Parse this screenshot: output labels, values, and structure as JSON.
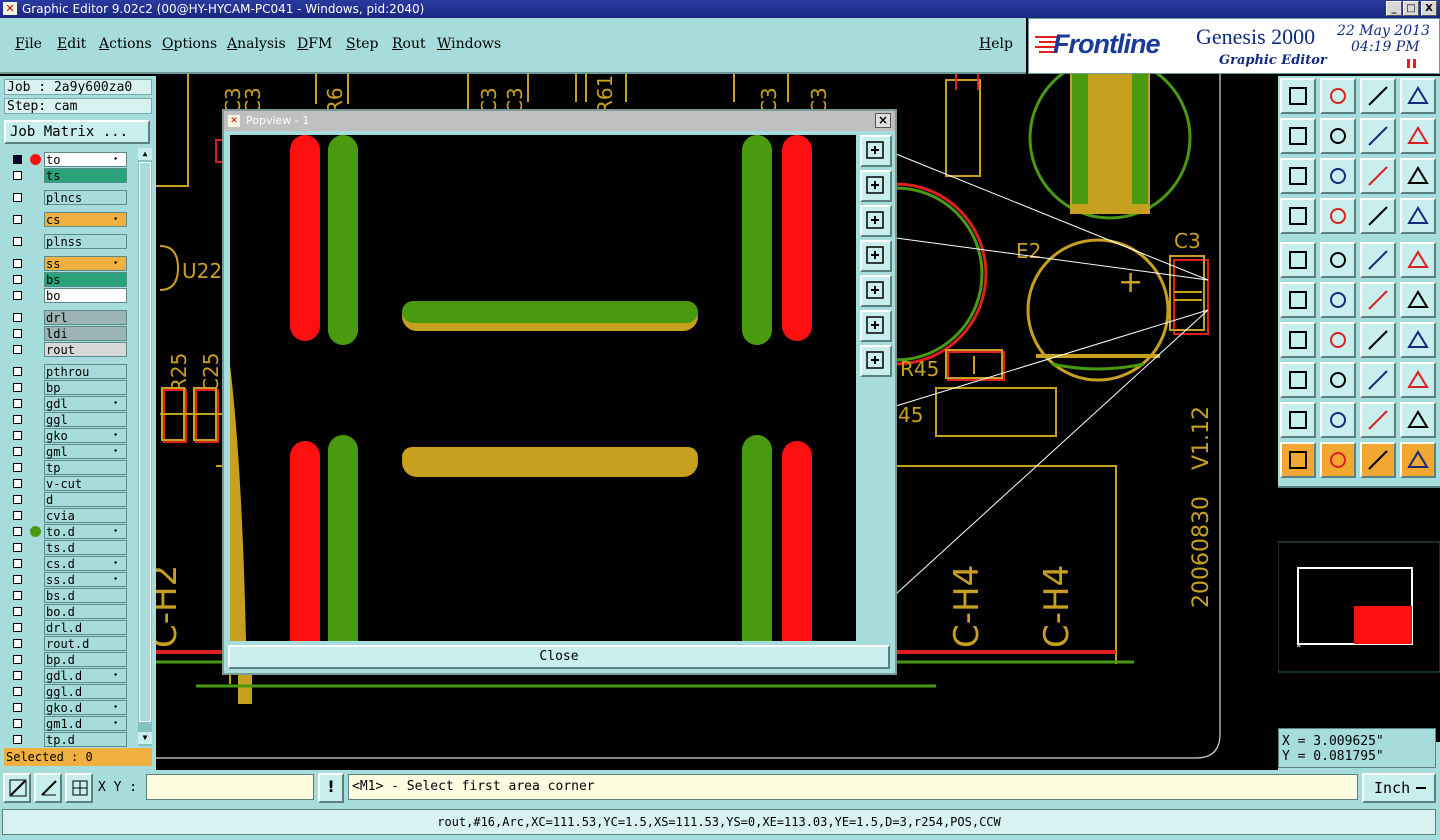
{
  "window": {
    "title": "Graphic Editor 9.02c2 (00@HY-HYCAM-PC041 - Windows, pid:2040)",
    "minimize_glyph": "_",
    "maximize_glyph": "□",
    "close_glyph": "X"
  },
  "menu": {
    "items": [
      {
        "first": "F",
        "rest": "ile"
      },
      {
        "first": "E",
        "rest": "dit"
      },
      {
        "first": "A",
        "rest": "ctions"
      },
      {
        "first": "O",
        "rest": "ptions"
      },
      {
        "first": "A",
        "rest": "nalysis"
      },
      {
        "first": "D",
        "rest": "FM"
      },
      {
        "first": "S",
        "rest": "tep"
      },
      {
        "first": "R",
        "rest": "out"
      },
      {
        "first": "W",
        "rest": "indows"
      }
    ],
    "help": {
      "first": "H",
      "rest": "elp"
    }
  },
  "brand": {
    "logo": "Frontline",
    "product": "Genesis 2000",
    "date": "22 May 2013",
    "time": "04:19 PM",
    "subtitle": "Graphic Editor"
  },
  "job": {
    "job_label": "Job : 2a9y600za0",
    "step_label": "Step: cam",
    "matrix_button": "Job Matrix ..."
  },
  "layers": [
    {
      "name": "to",
      "color": "#ffffff",
      "checked": true,
      "marker": "⬩"
    },
    {
      "name": "ts",
      "color": "#2ba37a",
      "checked": false,
      "marker": ""
    },
    {
      "name": "plncs",
      "color": "#a6dcdc",
      "checked": false,
      "marker": ""
    },
    {
      "name": "cs",
      "color": "#f0b040",
      "checked": false,
      "marker": "⬩"
    },
    {
      "name": "plnss",
      "color": "#a6dcdc",
      "checked": false,
      "marker": ""
    },
    {
      "name": "ss",
      "color": "#f0b040",
      "checked": false,
      "marker": "⬩"
    },
    {
      "name": "bs",
      "color": "#2ba37a",
      "checked": false,
      "marker": ""
    },
    {
      "name": "bo",
      "color": "#ffffff",
      "checked": false,
      "marker": ""
    },
    {
      "name": "drl",
      "color": "#9cb4b4",
      "checked": false,
      "marker": ""
    },
    {
      "name": "ldi",
      "color": "#9cb4b4",
      "checked": false,
      "marker": ""
    },
    {
      "name": "rout",
      "color": "#d8d8d8",
      "checked": false,
      "marker": ""
    },
    {
      "name": "pthrou",
      "color": "#a6dcdc",
      "checked": false,
      "marker": ""
    },
    {
      "name": "bp",
      "color": "#a6dcdc",
      "checked": false,
      "marker": ""
    },
    {
      "name": "gdl",
      "color": "#a6dcdc",
      "checked": false,
      "marker": "⬩"
    },
    {
      "name": "ggl",
      "color": "#a6dcdc",
      "checked": false,
      "marker": ""
    },
    {
      "name": "gko",
      "color": "#a6dcdc",
      "checked": false,
      "marker": "⬩"
    },
    {
      "name": "gml",
      "color": "#a6dcdc",
      "checked": false,
      "marker": "⬩"
    },
    {
      "name": "tp",
      "color": "#a6dcdc",
      "checked": false,
      "marker": ""
    },
    {
      "name": "v-cut",
      "color": "#a6dcdc",
      "checked": false,
      "marker": ""
    },
    {
      "name": "d",
      "color": "#a6dcdc",
      "checked": false,
      "marker": ""
    },
    {
      "name": "cvia",
      "color": "#a6dcdc",
      "checked": false,
      "marker": ""
    },
    {
      "name": "to.d",
      "color": "#a6dcdc",
      "checked": false,
      "marker": "⬩"
    },
    {
      "name": "ts.d",
      "color": "#a6dcdc",
      "checked": false,
      "marker": ""
    },
    {
      "name": "cs.d",
      "color": "#a6dcdc",
      "checked": false,
      "marker": "⬩"
    },
    {
      "name": "ss.d",
      "color": "#a6dcdc",
      "checked": false,
      "marker": "⬩"
    },
    {
      "name": "bs.d",
      "color": "#a6dcdc",
      "checked": false,
      "marker": ""
    },
    {
      "name": "bo.d",
      "color": "#a6dcdc",
      "checked": false,
      "marker": ""
    },
    {
      "name": "drl.d",
      "color": "#a6dcdc",
      "checked": false,
      "marker": ""
    },
    {
      "name": "rout.d",
      "color": "#a6dcdc",
      "checked": false,
      "marker": ""
    },
    {
      "name": "bp.d",
      "color": "#a6dcdc",
      "checked": false,
      "marker": ""
    },
    {
      "name": "gdl.d",
      "color": "#a6dcdc",
      "checked": false,
      "marker": "⬩"
    },
    {
      "name": "ggl.d",
      "color": "#a6dcdc",
      "checked": false,
      "marker": ""
    },
    {
      "name": "gko.d",
      "color": "#a6dcdc",
      "checked": false,
      "marker": "⬩"
    },
    {
      "name": "gm1.d",
      "color": "#a6dcdc",
      "checked": false,
      "marker": "⬩"
    },
    {
      "name": "tp.d",
      "color": "#a6dcdc",
      "checked": false,
      "marker": ""
    }
  ],
  "selected": "Selected : 0",
  "canvas_labels": {
    "u22": "U22",
    "r25": "R25",
    "c25": "C25",
    "e2": "E2",
    "c3": "C3",
    "r45": "R45",
    "r45_partial": "45",
    "version": "V1.12",
    "date_code": "20060830",
    "ch4_a": "C-H4",
    "ch4_b": "C-H4",
    "top_labels": [
      "C3",
      "C3",
      "R6",
      "C3",
      "C3",
      "R61",
      "C3",
      "C3"
    ]
  },
  "popview": {
    "title": "Popview - 1",
    "close_button": "Close",
    "close_glyph": "×"
  },
  "bottom": {
    "xy_label": "X Y :",
    "xy_value": "",
    "prompt": "<M1> - Select first area corner",
    "units": "Inch",
    "warn_glyph": "!"
  },
  "coords": {
    "x": "X = 3.009625\"",
    "y": "Y = 0.081795\""
  },
  "status": "rout,#16,Arc,XC=111.53,YC=1.5,XS=111.53,YS=0,XE=113.03,YE=1.5,D=3,r254,POS,CCW",
  "colors": {
    "panel": "#a6dcdc",
    "gold": "#c8a020",
    "green": "#4a9a10",
    "red": "#ff1010",
    "selected_tool": "#f0a830"
  }
}
